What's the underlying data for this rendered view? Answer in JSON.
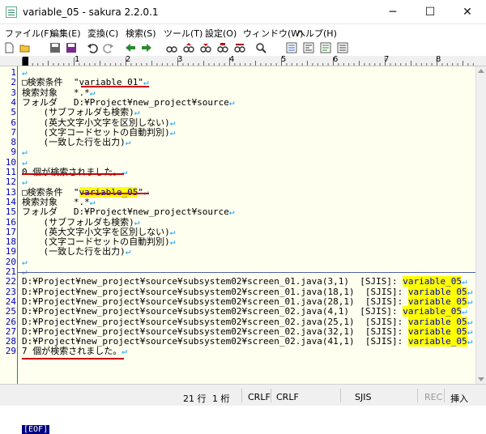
{
  "window": {
    "title": "variable_05 - sakura 2.2.0.1",
    "minimize": "─",
    "maximize": "☐",
    "close": "✕"
  },
  "menu": [
    "ファイル(F)",
    "編集(E)",
    "変換(C)",
    "検索(S)",
    "ツール(T)",
    "設定(O)",
    "ウィンドウ(W)",
    "ヘルプ(H)"
  ],
  "toolbar_icons": [
    "new-file-icon",
    "open-file-icon",
    "save-icon",
    "save-all-icon",
    "undo-icon",
    "redo-icon",
    "jump-back-icon",
    "jump-forward-icon",
    "search-icon",
    "search-prev-icon",
    "search-next-icon",
    "replace-icon",
    "grep-icon",
    "compare-icon",
    "outline-icon",
    "settings-icon",
    "font-icon",
    "help-icon"
  ],
  "ruler_marks": [
    "1",
    "2",
    "3",
    "4",
    "5",
    "6",
    "7",
    "8"
  ],
  "lines": [
    {
      "n": "1",
      "text": ""
    },
    {
      "n": "2",
      "text": "□検索条件  \"variable_01\""
    },
    {
      "n": "3",
      "text": "検索対象   *.*"
    },
    {
      "n": "4",
      "text": "フォルダ   D:¥Project¥new_project¥source"
    },
    {
      "n": "5",
      "text": "    (サブフォルダも検索)"
    },
    {
      "n": "6",
      "text": "    (英大文字小文字を区別しない)"
    },
    {
      "n": "7",
      "text": "    (文字コードセットの自動判別)"
    },
    {
      "n": "8",
      "text": "    (一致した行を出力)"
    },
    {
      "n": "9",
      "text": ""
    },
    {
      "n": "10",
      "text": ""
    },
    {
      "n": "11",
      "text": "0 個が検索されました。"
    },
    {
      "n": "12",
      "text": ""
    },
    {
      "n": "13",
      "text": "□検索条件  \"",
      "hl": "variable_05",
      "tail": "\""
    },
    {
      "n": "14",
      "text": "検索対象   *.*"
    },
    {
      "n": "15",
      "text": "フォルダ   D:¥Project¥new_project¥source"
    },
    {
      "n": "16",
      "text": "    (サブフォルダも検索)"
    },
    {
      "n": "17",
      "text": "    (英大文字小文字を区別しない)"
    },
    {
      "n": "18",
      "text": "    (文字コードセットの自動判別)"
    },
    {
      "n": "19",
      "text": "    (一致した行を出力)"
    },
    {
      "n": "20",
      "text": ""
    },
    {
      "n": "21",
      "text": ""
    },
    {
      "n": "22",
      "text": "D:¥Project¥new_project¥source¥subsystem02¥screen_01.java(3,1)  [SJIS]: ",
      "hl": "variable_05"
    },
    {
      "n": "23",
      "text": "D:¥Project¥new_project¥source¥subsystem02¥screen_01.java(18,1)  [SJIS]: ",
      "hl": "variable_05"
    },
    {
      "n": "24",
      "text": "D:¥Project¥new_project¥source¥subsystem02¥screen_01.java(28,1)  [SJIS]: ",
      "hl": "variable_05"
    },
    {
      "n": "25",
      "text": "D:¥Project¥new_project¥source¥subsystem02¥screen_02.java(4,1)  [SJIS]: ",
      "hl": "variable_05"
    },
    {
      "n": "26",
      "text": "D:¥Project¥new_project¥source¥subsystem02¥screen_02.java(25,1)  [SJIS]: ",
      "hl": "variable_05"
    },
    {
      "n": "27",
      "text": "D:¥Project¥new_project¥source¥subsystem02¥screen_02.java(32,1)  [SJIS]: ",
      "hl": "variable_05"
    },
    {
      "n": "28",
      "text": "D:¥Project¥new_project¥source¥subsystem02¥screen_02.java(41,1)  [SJIS]: ",
      "hl": "variable_05"
    },
    {
      "n": "29",
      "text": "7 個が検索されました。"
    }
  ],
  "eol_mark": "↵",
  "eof_label": "[EOF]",
  "status": {
    "line": "21 行",
    "col": "1 桁",
    "eol1": "CRLF",
    "eol2": "CRLF",
    "encoding": "SJIS",
    "rec": "REC",
    "mode": "挿入"
  },
  "colors": {
    "editor_bg": "#fffff0",
    "line_number": "#0000c0",
    "highlight": "#ffff00",
    "underline": "#cc0000"
  }
}
